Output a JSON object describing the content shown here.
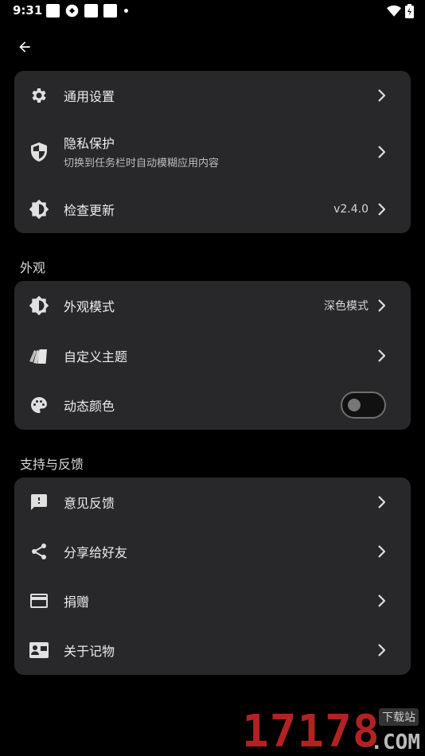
{
  "status_bar": {
    "time": "9:31"
  },
  "general_card": {
    "items": [
      {
        "label": "通用设置",
        "icon": "gear-icon"
      },
      {
        "label": "隐私保护",
        "sub": "切换到任务栏时自动模糊应用内容",
        "icon": "shield-icon"
      },
      {
        "label": "检查更新",
        "value": "v2.4.0",
        "icon": "brightness-icon"
      }
    ]
  },
  "appearance": {
    "title": "外观",
    "items": [
      {
        "label": "外观模式",
        "value": "深色模式",
        "icon": "brightness-icon"
      },
      {
        "label": "自定义主题",
        "icon": "cards-icon"
      },
      {
        "label": "动态颜色",
        "icon": "palette-icon",
        "toggle_on": false
      }
    ]
  },
  "support": {
    "title": "支持与反馈",
    "items": [
      {
        "label": "意见反馈",
        "icon": "feedback-icon"
      },
      {
        "label": "分享给好友",
        "icon": "share-icon"
      },
      {
        "label": "捐赠",
        "icon": "credit-card-icon"
      },
      {
        "label": "关于记物",
        "icon": "contact-card-icon"
      }
    ]
  },
  "watermark": {
    "number": "17178",
    "domain": ".COM",
    "tag": "下载站"
  },
  "colors": {
    "background": "#000000",
    "card": "#28282b",
    "watermark_red": "#b22222"
  }
}
